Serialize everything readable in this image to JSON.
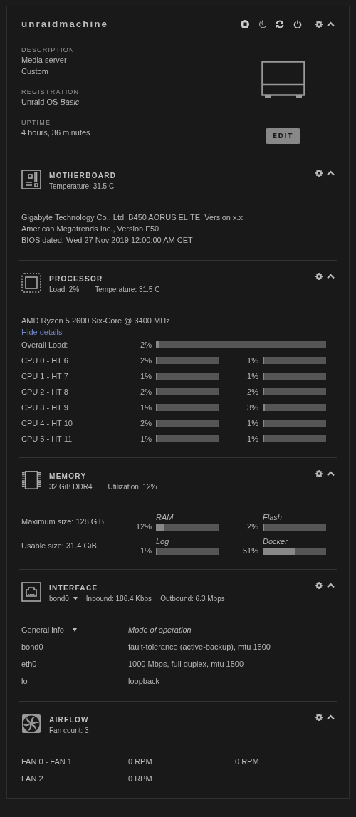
{
  "header": {
    "title": "unraidmachine",
    "fields": [
      {
        "label": "DESCRIPTION",
        "lines": [
          "Media server",
          "Custom"
        ]
      },
      {
        "label": "REGISTRATION",
        "lines": [
          "Unraid OS *Basic*"
        ]
      },
      {
        "label": "UPTIME",
        "lines": [
          "4 hours, 36 minutes"
        ]
      }
    ],
    "edit_button": "EDIT"
  },
  "sections": [
    {
      "kind": "motherboard",
      "title": "MOTHERBOARD",
      "stats": [
        "Temperature: 31.5 C"
      ],
      "lines": [
        "Gigabyte Technology Co., Ltd. B450 AORUS ELITE, Version x.x",
        "American Megatrends Inc., Version F50",
        "BIOS dated: Wed 27 Nov 2019 12:00:00 AM CET"
      ]
    },
    {
      "kind": "processor",
      "title": "PROCESSOR",
      "stats": [
        "Load: 2%",
        "Temperature: 31.5 C"
      ],
      "model": "AMD Ryzen 5 2600 Six-Core @ 3400 MHz",
      "link": "Hide details",
      "overall": {
        "label": "Overall Load:",
        "reading": "2%",
        "level": 0.02
      },
      "cores": [
        {
          "label": "CPU 0 - HT 6",
          "threads": [
            {
              "reading": "2%",
              "level": 0.02
            },
            {
              "reading": "1%",
              "level": 0.01
            }
          ]
        },
        {
          "label": "CPU 1 - HT 7",
          "threads": [
            {
              "reading": "1%",
              "level": 0.01
            },
            {
              "reading": "1%",
              "level": 0.01
            }
          ]
        },
        {
          "label": "CPU 2 - HT 8",
          "threads": [
            {
              "reading": "2%",
              "level": 0.02
            },
            {
              "reading": "2%",
              "level": 0.02
            }
          ]
        },
        {
          "label": "CPU 3 - HT 9",
          "threads": [
            {
              "reading": "1%",
              "level": 0.01
            },
            {
              "reading": "3%",
              "level": 0.03
            }
          ]
        },
        {
          "label": "CPU 4 - HT 10",
          "threads": [
            {
              "reading": "2%",
              "level": 0.02
            },
            {
              "reading": "1%",
              "level": 0.01
            }
          ]
        },
        {
          "label": "CPU 5 - HT 11",
          "threads": [
            {
              "reading": "1%",
              "level": 0.01
            },
            {
              "reading": "1%",
              "level": 0.01
            }
          ]
        }
      ]
    },
    {
      "kind": "memory",
      "title": "MEMORY",
      "stats": [
        "32 GiB DDR4",
        "Utilization: 12%"
      ],
      "rows": [
        {
          "label": "Maximum size: 128 GiB",
          "meters": [
            {
              "name": "RAM",
              "reading": "12%",
              "level": 0.12
            },
            {
              "name": "Flash",
              "reading": "2%",
              "level": 0.02
            }
          ]
        },
        {
          "label": "Usable size: 31.4 GiB",
          "meters": [
            {
              "name": "Log",
              "reading": "1%",
              "level": 0.01
            },
            {
              "name": "Docker",
              "reading": "51%",
              "level": 0.51
            }
          ]
        }
      ]
    },
    {
      "kind": "interface",
      "title": "INTERFACE",
      "selector": "bond0",
      "stats": [
        "Inbound: 186.4 Kbps",
        "Outbound: 6.3 Mbps"
      ],
      "columns": [
        "General info",
        "Mode of operation"
      ],
      "rows": [
        {
          "name": "bond0",
          "mode": "fault-tolerance (active-backup), mtu 1500"
        },
        {
          "name": "eth0",
          "mode": "1000 Mbps, full duplex, mtu 1500"
        },
        {
          "name": "lo",
          "mode": "loopback"
        }
      ]
    },
    {
      "kind": "airflow",
      "title": "AIRFLOW",
      "stats": [
        "Fan count: 3"
      ],
      "rows": [
        {
          "label": "FAN 0 - FAN 1",
          "values": [
            "0 RPM",
            "0 RPM"
          ]
        },
        {
          "label": "FAN 2",
          "values": [
            "0 RPM"
          ]
        }
      ]
    }
  ]
}
